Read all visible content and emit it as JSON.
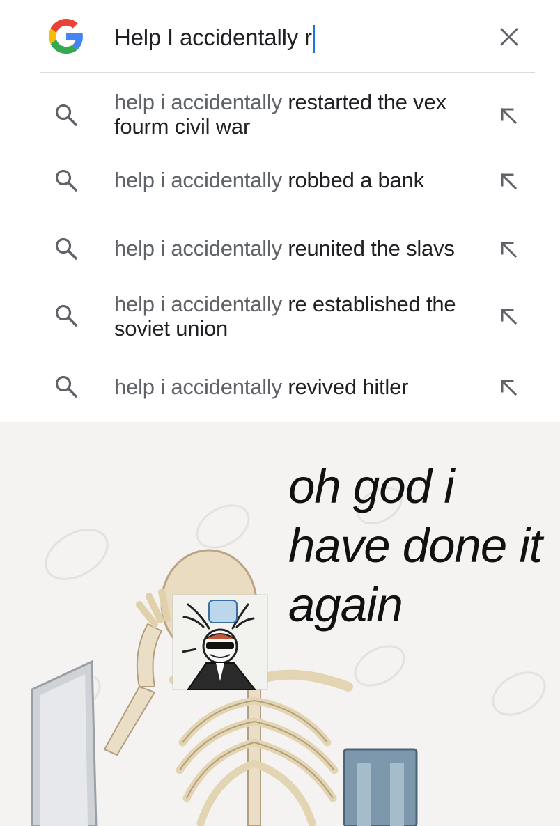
{
  "search": {
    "query": "Help I accidentally r",
    "logo_letter": "G"
  },
  "suggestions": [
    {
      "prefix": "help i accidentally ",
      "completion": "restarted the vex fourm civil war"
    },
    {
      "prefix": "help i accidentally ",
      "completion": "robbed a bank"
    },
    {
      "prefix": "help i accidentally ",
      "completion": "reunited the slavs"
    },
    {
      "prefix": "help i accidentally ",
      "completion": "re established the soviet union"
    },
    {
      "prefix": "help i accidentally ",
      "completion": "revived hitler"
    }
  ],
  "meme": {
    "caption": "oh god i have done it again"
  },
  "colors": {
    "google_blue": "#4285F4",
    "google_red": "#EA4335",
    "google_yellow": "#FBBC05",
    "google_green": "#34A853",
    "caret": "#1a73e8",
    "icon_gray": "#5f6368"
  },
  "icons": {
    "logo": "google-g-logo",
    "clear": "close-icon",
    "suggestion": "search-icon",
    "fill": "arrow-up-left-icon"
  }
}
